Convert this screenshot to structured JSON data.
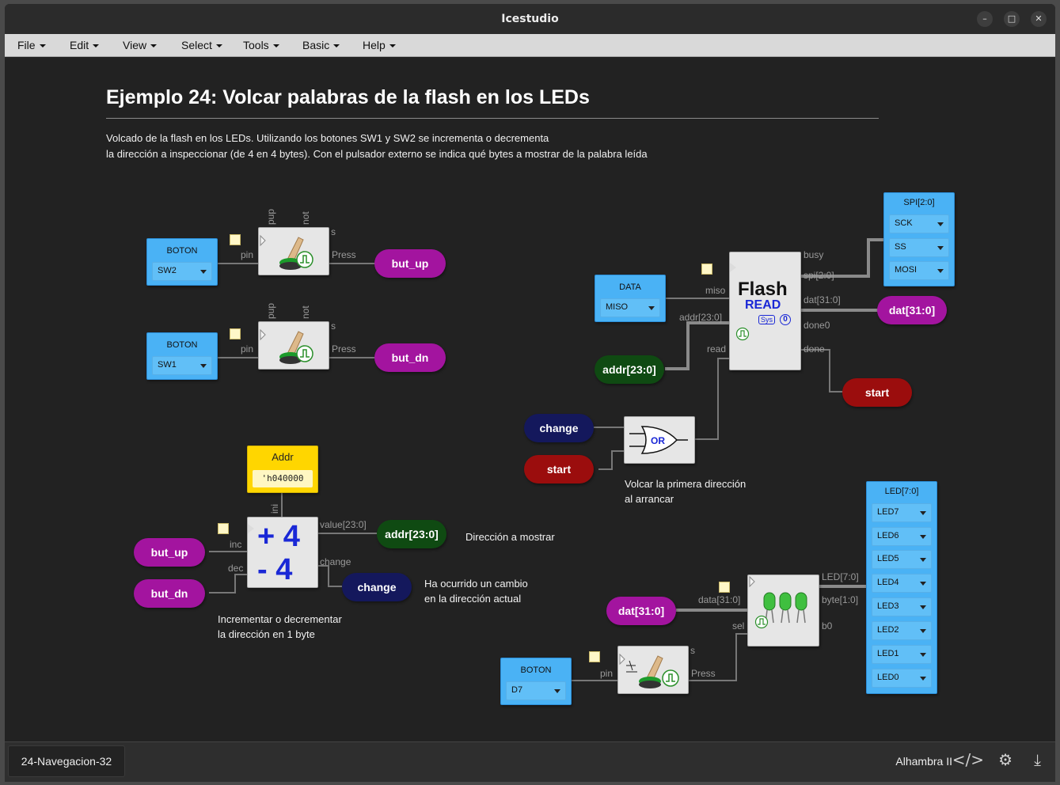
{
  "window": {
    "title": "Icestudio"
  },
  "menu": [
    "File",
    "Edit",
    "View",
    "Select",
    "Tools",
    "Basic",
    "Help"
  ],
  "heading": "Ejemplo 24: Volcar palabras de la flash en los LEDs",
  "description": [
    "Volcado de la flash en los LEDs. Utilizando los botones SW1 y SW2 se incrementa o decrementa",
    "la dirección a inspeccionar (de 4 en 4 bytes). Con el pulsador externo se indica qué bytes a mostrar de la palabra leída"
  ],
  "inputs": {
    "sw2": {
      "label": "BOTON",
      "value": "SW2"
    },
    "sw1": {
      "label": "BOTON",
      "value": "SW1"
    },
    "data": {
      "label": "DATA",
      "value": "MISO"
    },
    "d7": {
      "label": "BOTON",
      "value": "D7"
    }
  },
  "pins": {
    "pup": "pup",
    "not": "not",
    "s": "s",
    "pin": "pin",
    "press": "Press",
    "miso": "miso",
    "addr": "addr[23:0]",
    "read": "read",
    "busy": "busy",
    "spi": "spi[2:0]",
    "dat": "dat[31:0]",
    "done0": "done0",
    "done": "done",
    "ini": "ini",
    "inc": "inc",
    "dec": "dec",
    "value": "value[23:0]",
    "change": "change",
    "data": "data[31:0]",
    "sel": "sel",
    "led": "LED[7:0]",
    "byte": "byte[1:0]",
    "b0": "b0"
  },
  "tags": {
    "but_up": "but_up",
    "but_dn": "but_dn",
    "dat": "dat[31:0]",
    "addr": "addr[23:0]",
    "start": "start",
    "change": "change"
  },
  "flash": {
    "title": "Flash",
    "subtitle": "READ",
    "sys": "Sys",
    "zero": "0"
  },
  "or_gate": {
    "label": "OR"
  },
  "counter": {
    "plus": "+ 4",
    "minus": "- 4"
  },
  "addr_const": {
    "label": "Addr",
    "value": "'h040000"
  },
  "spi_out": {
    "label": "SPI[2:0]",
    "items": [
      "SCK",
      "SS",
      "MOSI"
    ]
  },
  "led_out": {
    "label": "LED[7:0]",
    "items": [
      "LED7",
      "LED6",
      "LED5",
      "LED4",
      "LED3",
      "LED2",
      "LED1",
      "LED0"
    ]
  },
  "notes": {
    "first1": "Volcar la primera dirección",
    "first2": "al arrancar",
    "show": "Dirección a mostrar",
    "changed1": "Ha ocurrido un cambio",
    "changed2": "en la dirección actual",
    "incdec1": "Incrementar o decrementar",
    "incdec2": "la dirección en 1 byte"
  },
  "footer": {
    "project": "24-Navegacion-32",
    "board": "Alhambra II"
  },
  "colors": {
    "input": "#4ab2f5",
    "purple": "#a3149f",
    "green": "#0f4a12",
    "navy": "#14185c",
    "red": "#9b0d0d",
    "const": "#ffd600"
  }
}
